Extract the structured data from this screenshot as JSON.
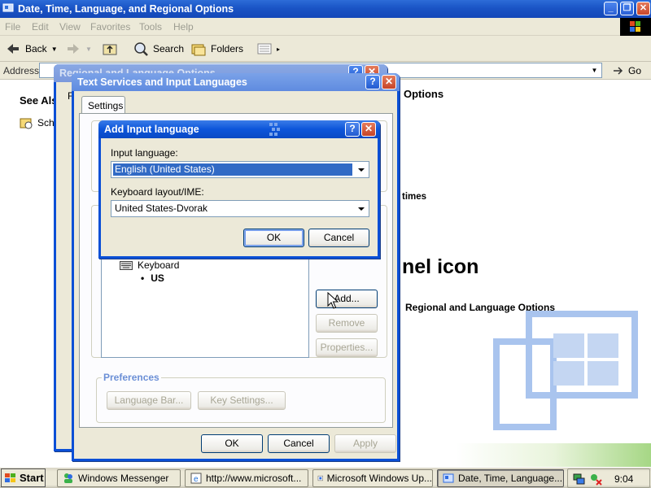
{
  "window": {
    "title": "Date, Time, Language, and Regional Options",
    "minimize": "_",
    "maximize": "❐",
    "close": "✕"
  },
  "menu": [
    "File",
    "Edit",
    "View",
    "Favorites",
    "Tools",
    "Help"
  ],
  "toolbar": {
    "back": "Back",
    "search": "Search",
    "folders": "Folders"
  },
  "address": {
    "label": "Address",
    "go": "Go"
  },
  "content": {
    "see_also": "See Als",
    "sched": "Sche",
    "options_heading": "Options",
    "times": "times",
    "panel_icon": "nel icon",
    "regional": "Regional and Language Options"
  },
  "regional_dialog": {
    "title": "Regional and Language Options",
    "tab_initial": "F"
  },
  "text_services": {
    "title": "Text Services and Input Languages",
    "tab": "Settings",
    "keyboard_label": "Keyboard",
    "keyboard_item": "US",
    "add": "Add...",
    "remove": "Remove",
    "properties": "Properties...",
    "preferences": "Preferences",
    "language_bar": "Language Bar...",
    "key_settings": "Key Settings...",
    "ok": "OK",
    "cancel": "Cancel",
    "apply": "Apply"
  },
  "add_input": {
    "title": "Add Input language",
    "help": "?",
    "close": "✕",
    "input_language_label": "Input language:",
    "input_language_value": "English (United States)",
    "layout_label": "Keyboard layout/IME:",
    "layout_value": "United States-Dvorak",
    "ok": "OK",
    "cancel": "Cancel"
  },
  "taskbar": {
    "start": "Start",
    "tasks": [
      "Windows Messenger",
      "http://www.microsoft...",
      "Microsoft Windows Up...",
      "Date, Time, Language..."
    ],
    "clock": "9:04"
  },
  "colors": {
    "xp_blue": "#0a4fd6",
    "face": "#ece9d8",
    "selection": "#316ac5"
  }
}
